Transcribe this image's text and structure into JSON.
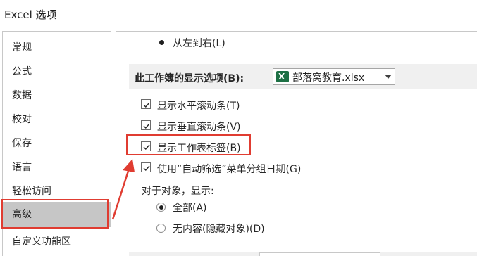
{
  "window": {
    "title": "Excel 选项"
  },
  "nav": {
    "items": [
      {
        "label": "常规"
      },
      {
        "label": "公式"
      },
      {
        "label": "数据"
      },
      {
        "label": "校对"
      },
      {
        "label": "保存"
      },
      {
        "label": "语言"
      },
      {
        "label": "轻松访问"
      },
      {
        "label": "高级",
        "selected": true
      },
      {
        "label": "自定义功能区"
      }
    ]
  },
  "content": {
    "direction_option": {
      "label": "从左到右(L)",
      "checked": true
    },
    "workbook_section": {
      "title": "此工作簿的显示选项(B):",
      "workbook_select": {
        "value": "部落窝教育.xlsx",
        "icon": "excel-file-icon"
      }
    },
    "checkboxes": [
      {
        "label": "显示水平滚动条(T)",
        "checked": true
      },
      {
        "label": "显示垂直滚动条(V)",
        "checked": true
      },
      {
        "label": "显示工作表标签(B)",
        "checked": true,
        "highlighted": true
      },
      {
        "label": "使用“自动筛选”菜单分组日期(G)",
        "checked": true
      }
    ],
    "objects_group": {
      "label": "对于对象，显示:",
      "options": [
        {
          "label": "全部(A)",
          "checked": true
        },
        {
          "label": "无内容(隐藏对象)(D)",
          "checked": false
        }
      ]
    }
  },
  "annotation": {
    "color": "#e03c31"
  }
}
